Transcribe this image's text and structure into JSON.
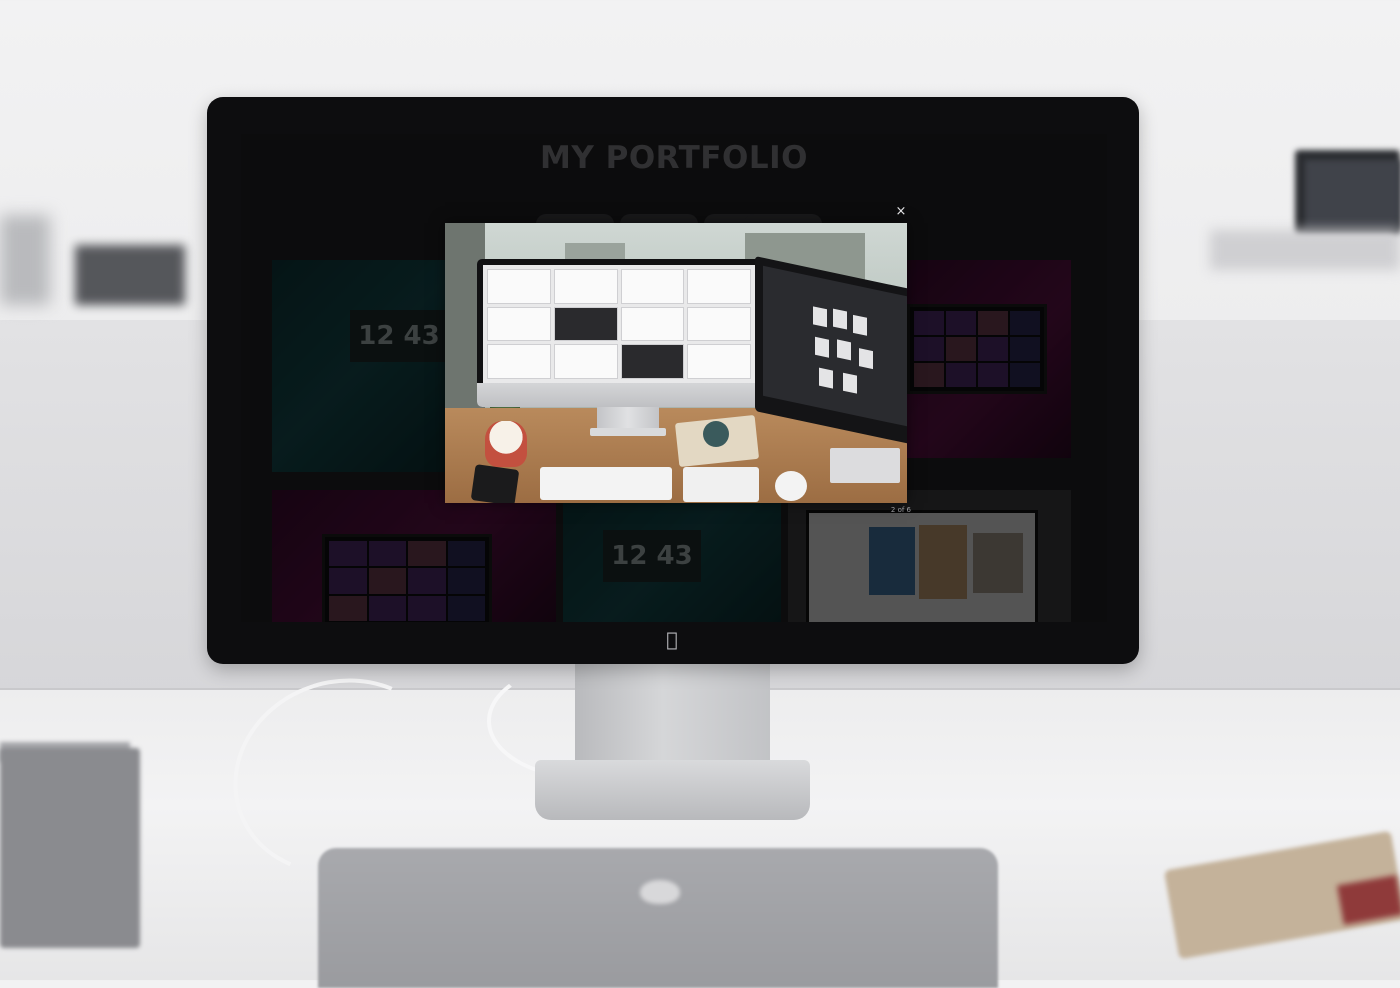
{
  "portfolio": {
    "title": "MY PORTFOLIO"
  },
  "gallery": {
    "thumbnails": [
      {
        "clock_text": "12 43",
        "theme": "teal"
      },
      {
        "clock_text": "12 43",
        "theme": "teal"
      }
    ]
  },
  "lightbox": {
    "close_label": "×",
    "counter": "2 of 6"
  },
  "icons": {
    "close": "close-icon",
    "apple": "apple-logo-icon"
  },
  "colors": {
    "overlay": "#000000",
    "bezel": "#0d0d0f",
    "title": "#545457"
  }
}
